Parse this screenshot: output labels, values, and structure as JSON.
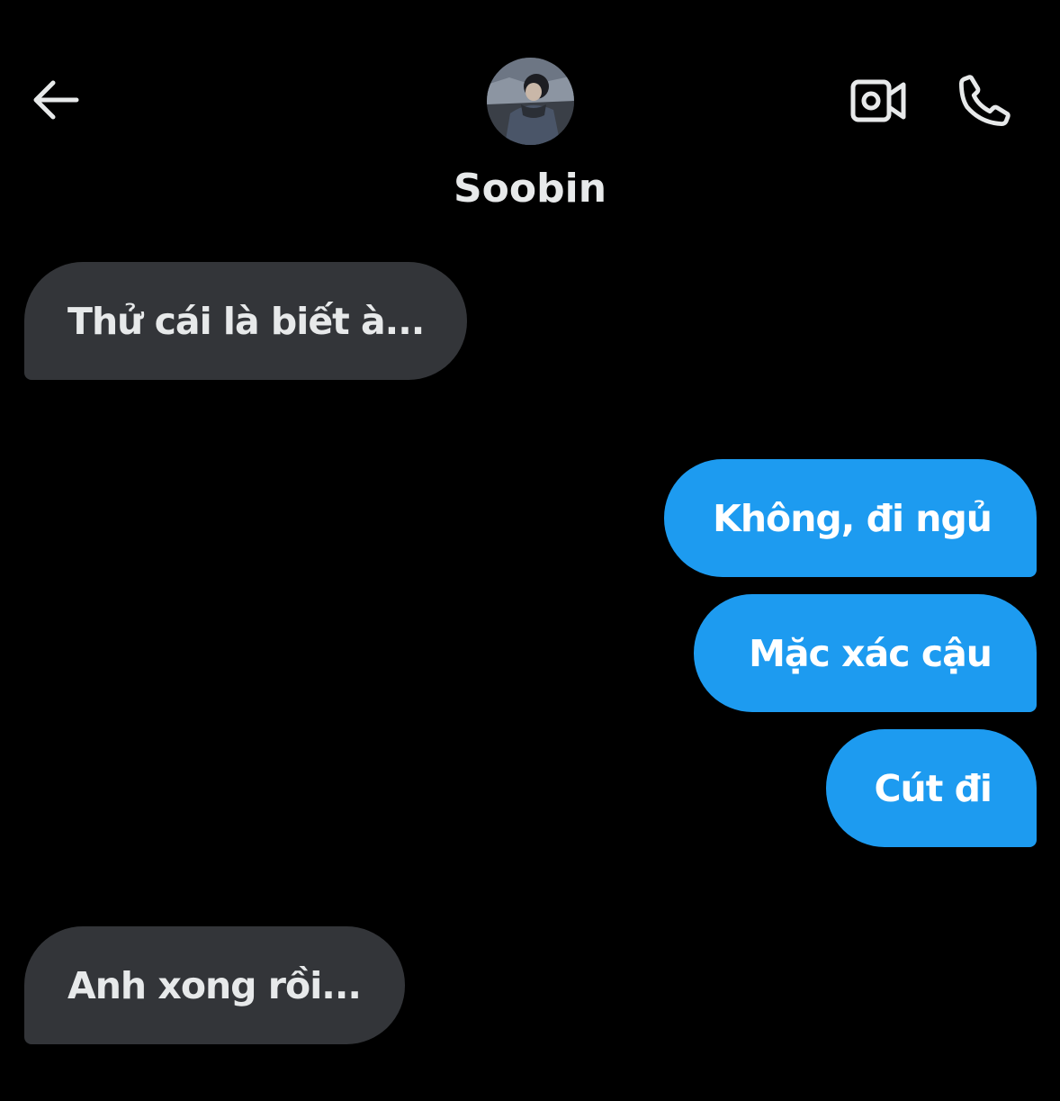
{
  "header": {
    "contact_name": "Soobin",
    "back_icon": "back-arrow-icon",
    "video_icon": "video-call-icon",
    "call_icon": "phone-call-icon"
  },
  "messages": [
    {
      "direction": "received",
      "text": "Thử cái là biết à..."
    },
    {
      "direction": "sent",
      "text": "Không, đi ngủ"
    },
    {
      "direction": "sent",
      "text": "Mặc xác cậu"
    },
    {
      "direction": "sent",
      "text": "Cút đi"
    },
    {
      "direction": "received",
      "text": "Anh xong rồi..."
    }
  ],
  "colors": {
    "background": "#000000",
    "received_bubble": "#333539",
    "sent_bubble": "#1d9bf0",
    "text": "#e7e9ea"
  }
}
